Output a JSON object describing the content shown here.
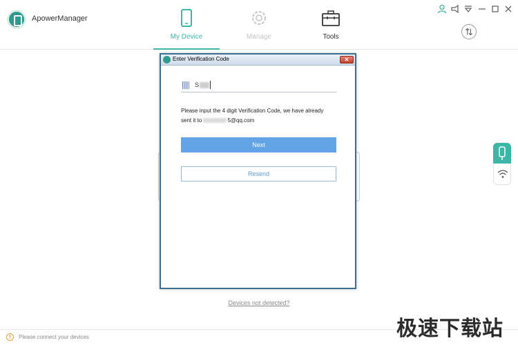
{
  "app": {
    "name": "ApowerManager"
  },
  "nav": {
    "tabs": [
      {
        "label": "My Device",
        "icon": "phone-icon",
        "active": true
      },
      {
        "label": "Manage",
        "icon": "gear-icon",
        "active": false
      },
      {
        "label": "Tools",
        "icon": "toolbox-icon",
        "active": false
      }
    ]
  },
  "window_controls": [
    "user-icon",
    "megaphone-icon",
    "settings-dropdown-icon",
    "minimize-icon",
    "maximize-icon",
    "close-icon"
  ],
  "side_buttons": [
    "usb-icon",
    "wifi-icon"
  ],
  "dialog": {
    "title": "Enter Verification Code",
    "close_label": "✕",
    "code_value": "S",
    "message_line1": "Please input the 4 digit Verification Code, we have already",
    "message_line2_prefix": "sent it to ",
    "message_line2_suffix": "5@qq.com",
    "next_label": "Next",
    "resend_label": "Resend"
  },
  "link_not_detected": "Devices not detected?",
  "status": {
    "text": "Please connect your devices",
    "icon": "!"
  },
  "watermark": "极速下载站",
  "colors": {
    "accent": "#3cb6a6",
    "primary_button": "#62a4e6",
    "resend_border": "#8fbce4",
    "warning": "#e39a3a"
  }
}
